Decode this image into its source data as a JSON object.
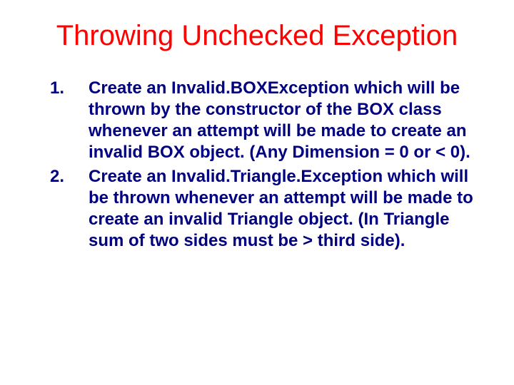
{
  "title": "Throwing Unchecked Exception",
  "items": [
    {
      "num": "1.",
      "text": "Create an Invalid.BOXException which will be thrown by the constructor of the BOX class whenever an attempt will be made to create an invalid BOX object. (Any Dimension = 0 or < 0)."
    },
    {
      "num": "2.",
      "text": "Create an Invalid.Triangle.Exception which will be thrown whenever an attempt will be made to create an invalid Triangle object. (In Triangle sum of two sides must be > third side)."
    }
  ]
}
